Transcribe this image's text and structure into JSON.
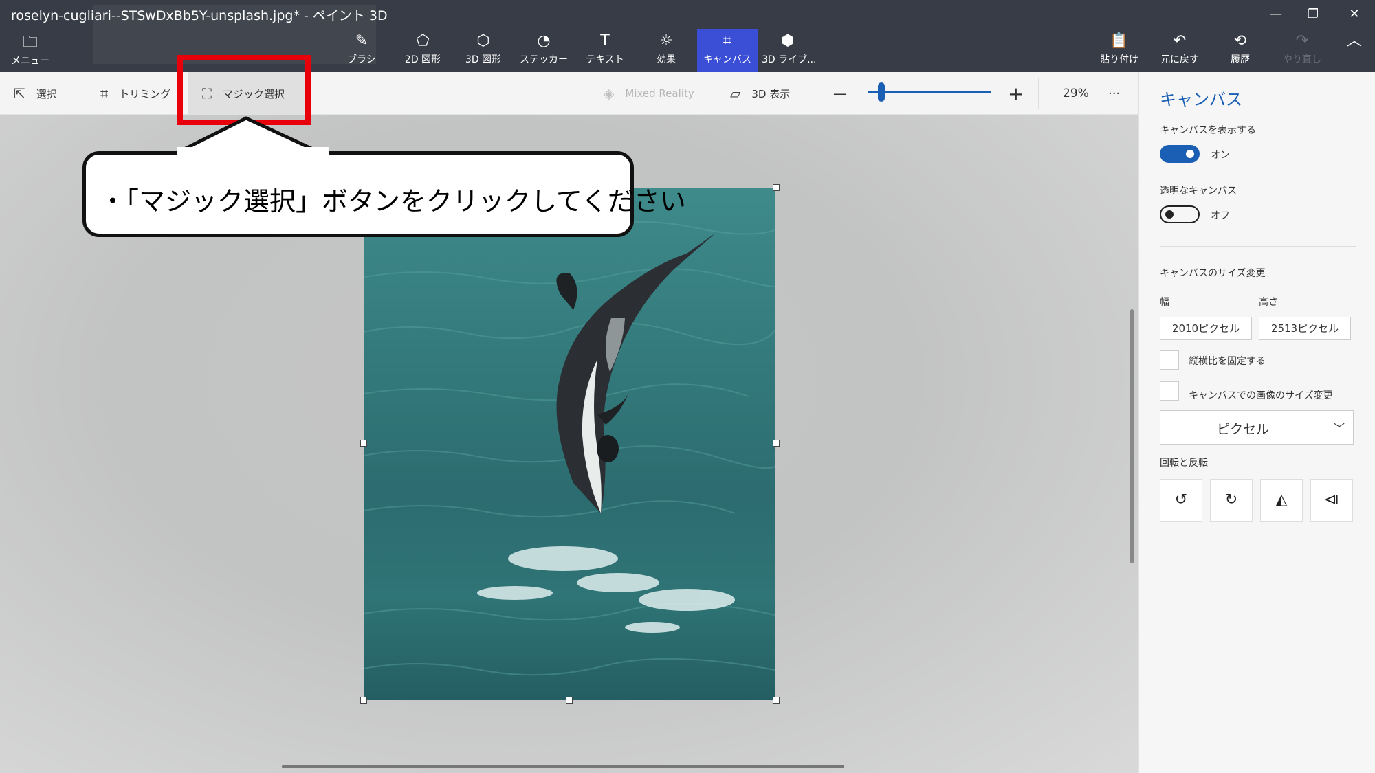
{
  "window": {
    "title": "roselyn-cugliari--STSwDxBb5Y-unsplash.jpg* - ペイント 3D",
    "controls": [
      "—",
      "❐",
      "✕"
    ]
  },
  "ribbon": {
    "menu": {
      "label": "メニュー",
      "icon": "folder-icon"
    },
    "tools": [
      {
        "label": "ブラシ",
        "icon": "brush-icon"
      },
      {
        "label": "2D 図形",
        "icon": "2d-shapes-icon"
      },
      {
        "label": "3D 図形",
        "icon": "3d-shapes-icon"
      },
      {
        "label": "ステッカー",
        "icon": "sticker-icon"
      },
      {
        "label": "テキスト",
        "icon": "text-icon"
      },
      {
        "label": "効果",
        "icon": "effects-icon"
      },
      {
        "label": "キャンバス",
        "icon": "canvas-icon",
        "active": true
      },
      {
        "label": "3D ライブ...",
        "icon": "3d-library-icon"
      }
    ],
    "actions": [
      {
        "label": "貼り付け",
        "icon": "paste-icon"
      },
      {
        "label": "元に戻す",
        "icon": "undo-icon"
      },
      {
        "label": "履歴",
        "icon": "history-icon"
      },
      {
        "label": "やり直し",
        "icon": "redo-icon",
        "disabled": true
      }
    ],
    "collapse_icon": "chevron-up-icon"
  },
  "subbar": {
    "select": "選択",
    "crop": "トリミング",
    "magic_select": "マジック選択",
    "mixed_reality": "Mixed Reality",
    "view_3d": "3D 表示",
    "zoom_out": "—",
    "zoom_in": "+",
    "zoom_level": "29%",
    "more": "···",
    "zoom_fraction": 0.1
  },
  "annotation": {
    "callout_text": "・「マジック選択」ボタンをクリックしてください"
  },
  "panel": {
    "title": "キャンバス",
    "show_canvas_label": "キャンバスを表示する",
    "show_canvas_state": "オン",
    "transparent_label": "透明なキャンバス",
    "transparent_state": "オフ",
    "resize_heading": "キャンバスのサイズ変更",
    "width_label": "幅",
    "height_label": "高さ",
    "width_value": "2010ピクセル",
    "height_value": "2513ピクセル",
    "lock_aspect_label": "縦横比を固定する",
    "resize_image_label": "キャンバスでの画像のサイズ変更",
    "unit": "ピクセル",
    "rotate_heading": "回転と反転"
  },
  "colors": {
    "accent": "#1a5fb4",
    "ribbon_bg": "#383c46",
    "active_tool": "#3a4fd6",
    "annotation_red": "#e8000b"
  }
}
